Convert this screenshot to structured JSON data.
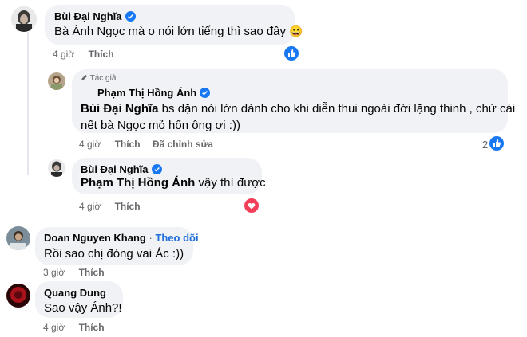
{
  "comments": [
    {
      "author": "Bùi Đại Nghĩa",
      "verified": true,
      "text": "Bà Ánh Ngọc mà o nói lớn tiếng thì sao đây",
      "emoji": "😀",
      "time": "4 giờ",
      "like_label": "Thích",
      "reaction": "like-icon"
    },
    {
      "author_tag": "Tác giả",
      "author": "Phạm Thị Hồng Ánh",
      "verified": true,
      "mention": "Bùi Đại Nghĩa",
      "text_line1": " bs dặn nói lớn dành cho khi diễn thui ngoài đời lặng thinh , chứ cái",
      "text_line2": "nết bà Ngọc mỏ hổn ông ơi :))",
      "time": "4 giờ",
      "like_label": "Thích",
      "edited_label": "Đã chỉnh sửa",
      "reaction_count": "2",
      "reaction": "like-icon"
    },
    {
      "author": "Bùi Đại Nghĩa",
      "verified": true,
      "mention": "Phạm Thị Hồng Ánh",
      "text": " vậy thì được",
      "time": "4 giờ",
      "like_label": "Thích",
      "reaction": "love-icon"
    },
    {
      "author": "Doan Nguyen Khang",
      "follow_sep": "·",
      "follow_label": "Theo dõi",
      "text": "Rồi sao chị đóng vai Ác :))",
      "time": "3 giờ",
      "like_label": "Thích"
    },
    {
      "author": "Quang Dung",
      "text": "Sao vậy Ánh?!",
      "time": "4 giờ",
      "like_label": "Thích"
    }
  ],
  "colors": {
    "bubble": "#f0f2f5",
    "meta": "#65676b",
    "link": "#216fdb",
    "like_blue": "#1877f2",
    "love_red": "#f33e58"
  }
}
